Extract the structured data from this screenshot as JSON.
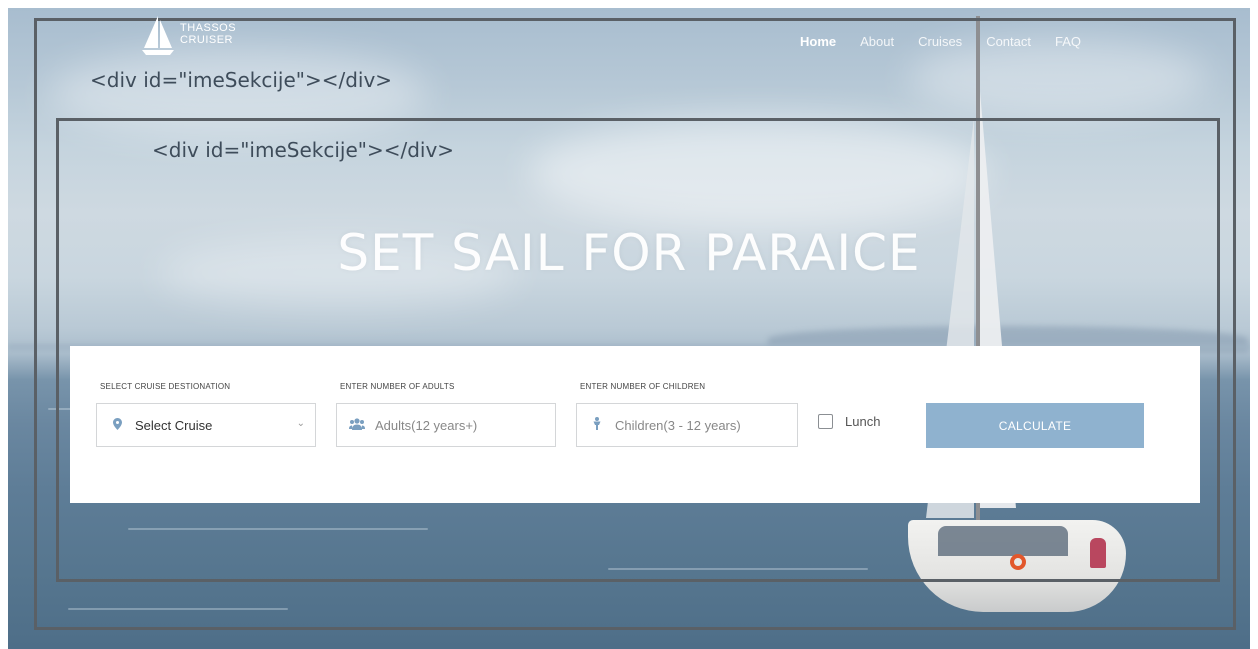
{
  "logo": {
    "line1": "THASSOS",
    "line2": "CRUISER",
    "icon": "sailboat-icon"
  },
  "nav": {
    "items": [
      {
        "label": "Home",
        "active": true
      },
      {
        "label": "About",
        "active": false
      },
      {
        "label": "Cruises",
        "active": false
      },
      {
        "label": "Contact",
        "active": false
      },
      {
        "label": "FAQ",
        "active": false
      }
    ]
  },
  "annotations": {
    "header_section": "<div id=\"imeSekcije\"></div>",
    "hero_section": "<div id=\"imeSekcije\"></div>"
  },
  "hero": {
    "title": "SET SAIL FOR PARAICE"
  },
  "booking": {
    "destination": {
      "label": "SELECT CRUISE DESTIONATION",
      "value": "Select Cruise",
      "icon": "map-pin-icon"
    },
    "adults": {
      "label": "ENTER NUMBER OF ADULTS",
      "placeholder": "Adults(12 years+)",
      "icon": "users-icon"
    },
    "children": {
      "label": "ENTER NUMBER OF CHILDREN",
      "placeholder": "Children(3 - 12 years)",
      "icon": "child-icon"
    },
    "lunch": {
      "label": "Lunch",
      "checked": false
    },
    "calculate_label": "CALCULATE"
  },
  "colors": {
    "accent": "#8fb2cf",
    "frame": "#5a6066",
    "annotation_text": "#3e4c5a"
  }
}
